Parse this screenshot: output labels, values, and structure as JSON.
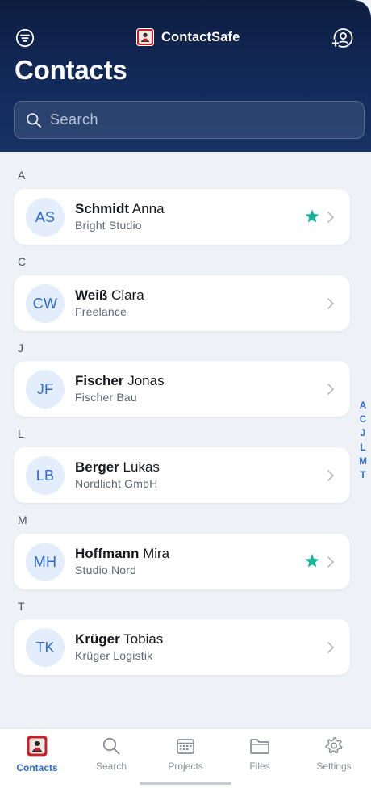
{
  "app": {
    "name": "ContactSafe",
    "title": "Contacts"
  },
  "search": {
    "placeholder": "Search"
  },
  "sections": [
    {
      "letter": "A",
      "contacts": [
        {
          "initials": "AS",
          "last": "Schmidt",
          "first": "Anna",
          "company": "Bright Studio",
          "favorite": true
        }
      ]
    },
    {
      "letter": "C",
      "contacts": [
        {
          "initials": "CW",
          "last": "Weiß",
          "first": "Clara",
          "company": "Freelance",
          "favorite": false
        }
      ]
    },
    {
      "letter": "J",
      "contacts": [
        {
          "initials": "JF",
          "last": "Fischer",
          "first": "Jonas",
          "company": "Fischer Bau",
          "favorite": false
        }
      ]
    },
    {
      "letter": "L",
      "contacts": [
        {
          "initials": "LB",
          "last": "Berger",
          "first": "Lukas",
          "company": "Nordlicht GmbH",
          "favorite": false
        }
      ]
    },
    {
      "letter": "M",
      "contacts": [
        {
          "initials": "MH",
          "last": "Hoffmann",
          "first": "Mira",
          "company": "Studio Nord",
          "favorite": true
        }
      ]
    },
    {
      "letter": "T",
      "contacts": [
        {
          "initials": "TK",
          "last": "Krüger",
          "first": "Tobias",
          "company": "Krüger Logistik",
          "favorite": false
        }
      ]
    }
  ],
  "alpha_index": [
    "A",
    "C",
    "J",
    "L",
    "M",
    "T"
  ],
  "tabs": [
    {
      "label": "Contacts",
      "icon": "contactsafe-logo-icon",
      "active": true
    },
    {
      "label": "Search",
      "icon": "search-icon",
      "active": false
    },
    {
      "label": "Projects",
      "icon": "projects-icon",
      "active": false
    },
    {
      "label": "Files",
      "icon": "folder-icon",
      "active": false
    },
    {
      "label": "Settings",
      "icon": "gear-icon",
      "active": false
    }
  ],
  "colors": {
    "header": "#132b5c",
    "accent": "#2f6bd0",
    "favorite": "#14b59a",
    "brand_red": "#c8202a"
  }
}
